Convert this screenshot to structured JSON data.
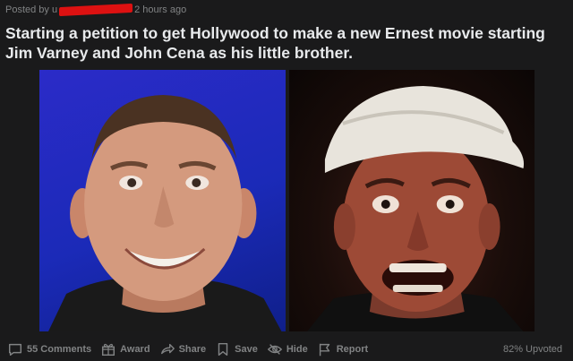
{
  "post": {
    "meta_prefix": "Posted by u",
    "meta_time": "2 hours ago",
    "title": "Starting a petition to get Hollywood to make a new Ernest movie starting Jim Varney and John Cena as his little brother."
  },
  "actions": {
    "comments": "55 Comments",
    "award": "Award",
    "share": "Share",
    "save": "Save",
    "hide": "Hide",
    "report": "Report",
    "upvoted": "82% Upvoted"
  },
  "colors": {
    "background": "#1a1a1b",
    "text": "#d7dadc",
    "muted": "#818384",
    "redaction": "#dd1111"
  },
  "media": {
    "left_panel": "photo-smiling-man-blue-background",
    "right_panel": "photo-man-in-white-cap-shouting"
  }
}
